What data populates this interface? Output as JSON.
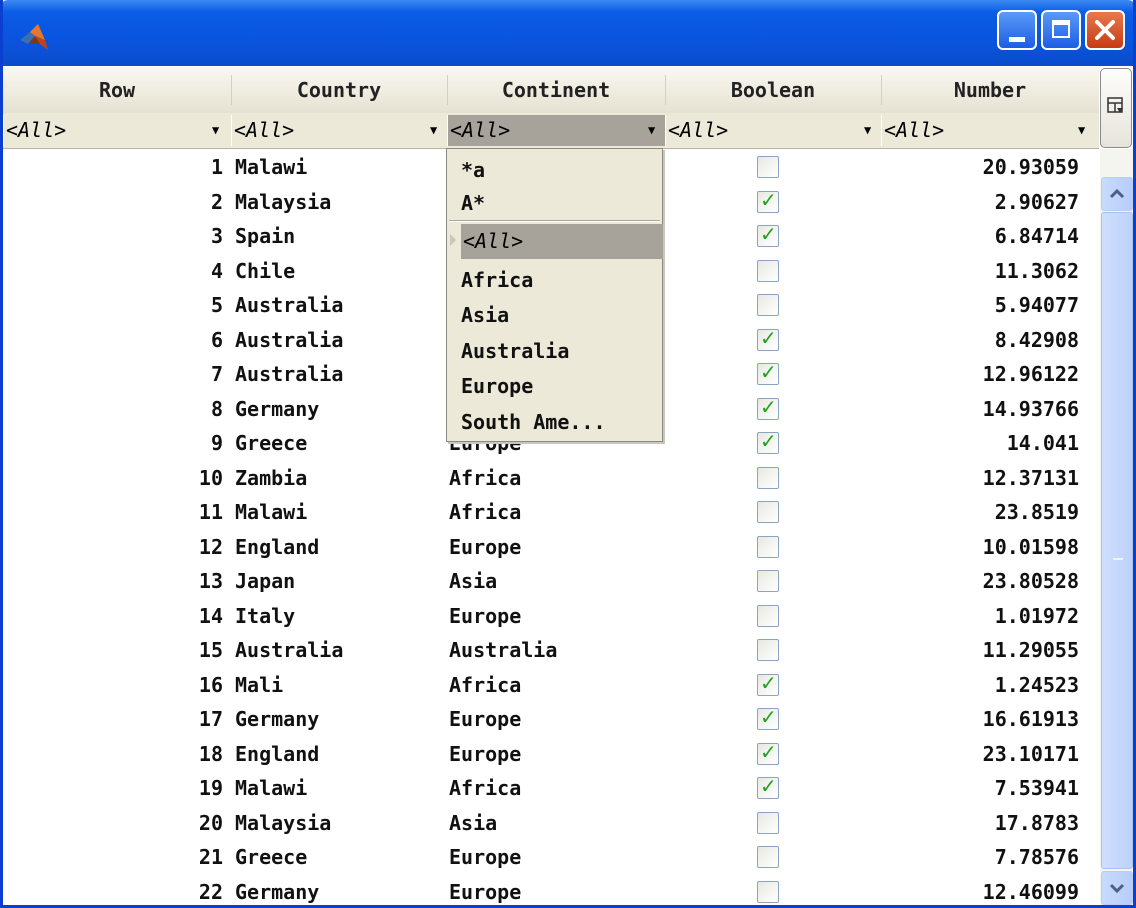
{
  "window": {
    "title": ""
  },
  "columns": [
    "Row",
    "Country",
    "Continent",
    "Boolean",
    "Number"
  ],
  "filters": [
    "<All>",
    "<All>",
    "<All>",
    "<All>",
    "<All>"
  ],
  "rows": [
    {
      "row": "1",
      "country": "Malawi",
      "continent": "",
      "checked": false,
      "number": "20.93059"
    },
    {
      "row": "2",
      "country": "Malaysia",
      "continent": "",
      "checked": true,
      "number": "2.90627"
    },
    {
      "row": "3",
      "country": "Spain",
      "continent": "",
      "checked": true,
      "number": "6.84714"
    },
    {
      "row": "4",
      "country": "Chile",
      "continent": "",
      "checked": false,
      "number": "11.3062"
    },
    {
      "row": "5",
      "country": "Australia",
      "continent": "",
      "checked": false,
      "number": "5.94077"
    },
    {
      "row": "6",
      "country": "Australia",
      "continent": "",
      "checked": true,
      "number": "8.42908"
    },
    {
      "row": "7",
      "country": "Australia",
      "continent": "",
      "checked": true,
      "number": "12.96122"
    },
    {
      "row": "8",
      "country": "Germany",
      "continent": "",
      "checked": true,
      "number": "14.93766"
    },
    {
      "row": "9",
      "country": "Greece",
      "continent": "Europe",
      "checked": true,
      "number": "14.041"
    },
    {
      "row": "10",
      "country": "Zambia",
      "continent": "Africa",
      "checked": false,
      "number": "12.37131"
    },
    {
      "row": "11",
      "country": "Malawi",
      "continent": "Africa",
      "checked": false,
      "number": "23.8519"
    },
    {
      "row": "12",
      "country": "England",
      "continent": "Europe",
      "checked": false,
      "number": "10.01598"
    },
    {
      "row": "13",
      "country": "Japan",
      "continent": "Asia",
      "checked": false,
      "number": "23.80528"
    },
    {
      "row": "14",
      "country": "Italy",
      "continent": "Europe",
      "checked": false,
      "number": "1.01972"
    },
    {
      "row": "15",
      "country": "Australia",
      "continent": "Australia",
      "checked": false,
      "number": "11.29055"
    },
    {
      "row": "16",
      "country": "Mali",
      "continent": "Africa",
      "checked": true,
      "number": "1.24523"
    },
    {
      "row": "17",
      "country": "Germany",
      "continent": "Europe",
      "checked": true,
      "number": "16.61913"
    },
    {
      "row": "18",
      "country": "England",
      "continent": "Europe",
      "checked": true,
      "number": "23.10171"
    },
    {
      "row": "19",
      "country": "Malawi",
      "continent": "Africa",
      "checked": true,
      "number": "7.53941"
    },
    {
      "row": "20",
      "country": "Malaysia",
      "continent": "Asia",
      "checked": false,
      "number": "17.8783"
    },
    {
      "row": "21",
      "country": "Greece",
      "continent": "Europe",
      "checked": false,
      "number": "7.78576"
    },
    {
      "row": "22",
      "country": "Germany",
      "continent": "Europe",
      "checked": false,
      "number": "12.46099"
    }
  ],
  "dropdown": {
    "patterns": [
      "*a",
      "A*"
    ],
    "selected": "<All>",
    "options": [
      "Africa",
      "Asia",
      "Australia",
      "Europe",
      "South Ame..."
    ]
  },
  "icons": {
    "app": "matlab-logo-icon",
    "minimize": "minimize-icon",
    "maximize": "maximize-icon",
    "close": "close-icon",
    "column_chooser": "column-chooser-icon",
    "filter_arrow": "dropdown-arrow-icon",
    "scroll_up": "chevron-up-icon",
    "scroll_down": "chevron-down-icon"
  },
  "colors": {
    "titlebar": "#0a54de",
    "close_button": "#c63b12",
    "check": "#21a21a",
    "selection": "#a7a39a",
    "header_bg": "#ece9d8"
  }
}
